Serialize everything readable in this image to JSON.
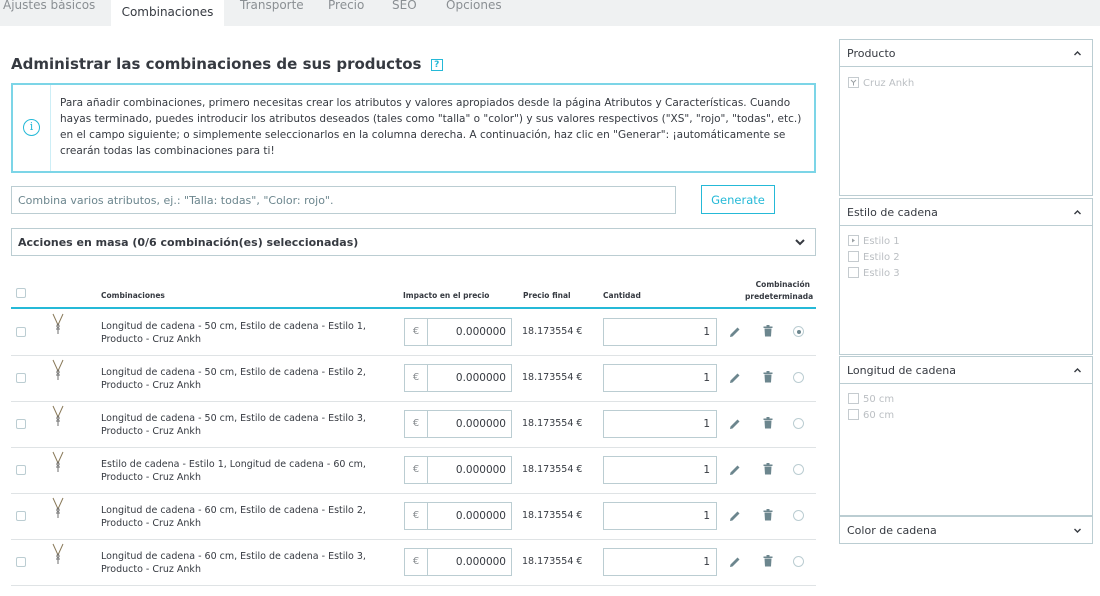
{
  "tabs": [
    {
      "label": "Ajustes básicos",
      "active": false
    },
    {
      "label": "Combinaciones",
      "active": true
    },
    {
      "label": "Transporte",
      "active": false
    },
    {
      "label": "Precio",
      "active": false
    },
    {
      "label": "SEO",
      "active": false
    },
    {
      "label": "Opciones",
      "active": false
    }
  ],
  "title": "Administrar las combinaciones de sus productos",
  "help_label": "?",
  "alert": {
    "icon": "info-icon",
    "text": "Para añadir combinaciones, primero necesitas crear los atributos y valores apropiados desde la página Atributos y Características. Cuando hayas terminado, puedes introducir los atributos deseados (tales como \"talla\" o \"color\") y sus valores respectivos (\"XS\", \"rojo\", \"todas\", etc.) en el campo siguiente; o simplemente seleccionarlos en la columna derecha. A continuación, haz clic en \"Generar\": ¡automáticamente se crearán todas las combinaciones para ti!"
  },
  "attributes_input": {
    "placeholder": "Combina varios atributos, ej.: \"Talla: todas\", \"Color: rojo\".",
    "value": ""
  },
  "generate_label": "Generate",
  "bulk_actions_label": "Acciones en masa (0/6 combinación(es) seleccionadas)",
  "table": {
    "headers": {
      "combinations": "Combinaciones",
      "price_impact": "Impacto en el precio",
      "final_price": "Precio final",
      "quantity": "Cantidad",
      "default_line1": "Combinación",
      "default_line2": "predeterminada"
    },
    "currency_symbol": "€",
    "rows": [
      {
        "name": "Longitud de cadena - 50 cm, Estilo de cadena - Estilo 1, Producto - Cruz Ankh",
        "impact": "0.000000",
        "final_price": "18.173554 €",
        "quantity": "1",
        "default": true
      },
      {
        "name": "Longitud de cadena - 50 cm, Estilo de cadena - Estilo 2, Producto - Cruz Ankh",
        "impact": "0.000000",
        "final_price": "18.173554 €",
        "quantity": "1",
        "default": false
      },
      {
        "name": "Longitud de cadena - 50 cm, Estilo de cadena - Estilo 3, Producto - Cruz Ankh",
        "impact": "0.000000",
        "final_price": "18.173554 €",
        "quantity": "1",
        "default": false
      },
      {
        "name": "Estilo de cadena - Estilo 1, Longitud de cadena - 60 cm, Producto - Cruz Ankh",
        "impact": "0.000000",
        "final_price": "18.173554 €",
        "quantity": "1",
        "default": false
      },
      {
        "name": "Longitud de cadena - 60 cm, Estilo de cadena - Estilo 2, Producto - Cruz Ankh",
        "impact": "0.000000",
        "final_price": "18.173554 €",
        "quantity": "1",
        "default": false
      },
      {
        "name": "Longitud de cadena - 60 cm, Estilo de cadena - Estilo 3, Producto - Cruz Ankh",
        "impact": "0.000000",
        "final_price": "18.173554 €",
        "quantity": "1",
        "default": false
      }
    ]
  },
  "attribute_panels": [
    {
      "title": "Producto",
      "expanded": true,
      "options": [
        {
          "label": "Cruz Ankh",
          "checked": true
        }
      ]
    },
    {
      "title": "Estilo de cadena",
      "expanded": true,
      "options": [
        {
          "label": "Estilo 1",
          "checked": true
        },
        {
          "label": "Estilo 2",
          "checked": false
        },
        {
          "label": "Estilo 3",
          "checked": false
        }
      ]
    },
    {
      "title": "Longitud de cadena",
      "expanded": true,
      "options": [
        {
          "label": "50 cm",
          "checked": false
        },
        {
          "label": "60 cm",
          "checked": false
        }
      ]
    },
    {
      "title": "Color de cadena",
      "expanded": false,
      "options": []
    }
  ],
  "colors": {
    "accent": "#25b9d7",
    "border": "#bbcdd2",
    "text": "#363a41",
    "tab_bar": "#eff1f2"
  }
}
